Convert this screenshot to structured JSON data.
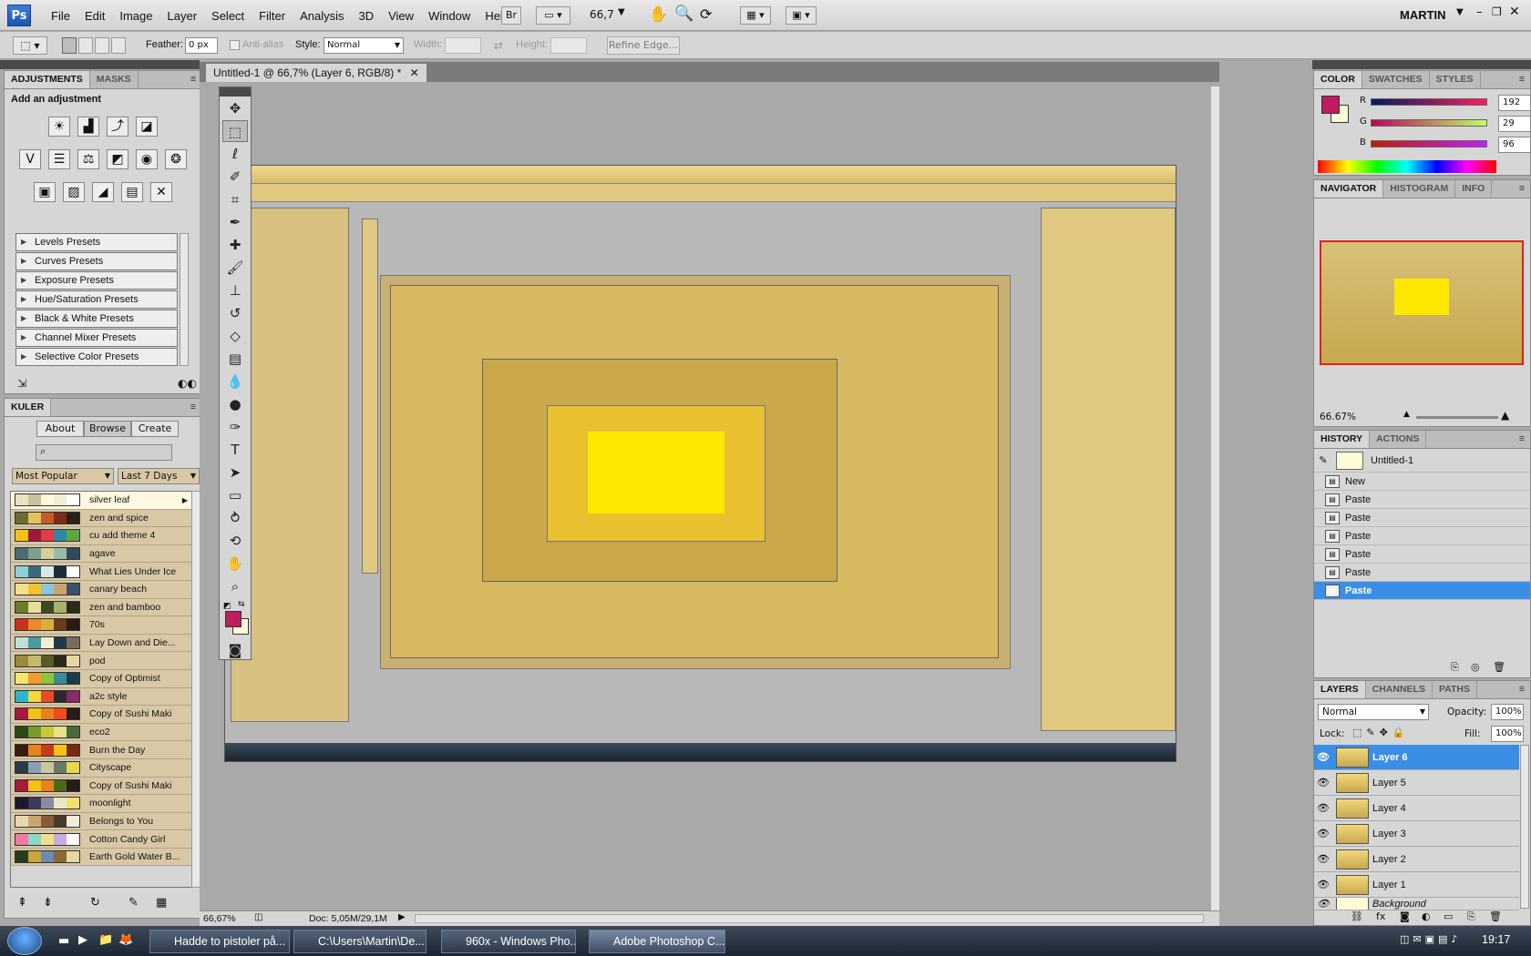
{
  "app": {
    "logo": "Ps",
    "user": "MARTIN"
  },
  "menu": [
    "File",
    "Edit",
    "Image",
    "Layer",
    "Select",
    "Filter",
    "Analysis",
    "3D",
    "View",
    "Window",
    "Help"
  ],
  "menubar": {
    "bridge": "Br",
    "zoom": "66,7"
  },
  "options": {
    "feather_label": "Feather:",
    "feather_value": "0 px",
    "antialias": "Anti-alias",
    "style_label": "Style:",
    "style_value": "Normal",
    "width_label": "Width:",
    "height_label": "Height:",
    "refine": "Refine Edge..."
  },
  "adjustments": {
    "tabs": [
      "ADJUSTMENTS",
      "MASKS"
    ],
    "title": "Add an adjustment",
    "presets": [
      "Levels Presets",
      "Curves Presets",
      "Exposure Presets",
      "Hue/Saturation Presets",
      "Black & White Presets",
      "Channel Mixer Presets",
      "Selective Color Presets"
    ]
  },
  "kuler": {
    "tab": "KULER",
    "buttons": [
      "About",
      "Browse",
      "Create"
    ],
    "filter1": "Most Popular",
    "filter2": "Last 7 Days",
    "themes": [
      {
        "name": "silver leaf",
        "colors": [
          "#e9e2c4",
          "#c9c29a",
          "#fff8d8",
          "#f2ecd2",
          "#ffffff"
        ]
      },
      {
        "name": "zen and spice",
        "colors": [
          "#6b6b33",
          "#e4c35a",
          "#c75b2a",
          "#7a2d18",
          "#2b2016"
        ]
      },
      {
        "name": "cu add theme 4",
        "colors": [
          "#f2c316",
          "#9c1a3a",
          "#e23b4a",
          "#2b8aa6",
          "#5ba63e"
        ]
      },
      {
        "name": "agave",
        "colors": [
          "#4d6c72",
          "#7e9f88",
          "#d5cf9c",
          "#9cb9a8",
          "#2f4a58"
        ]
      },
      {
        "name": "What Lies Under Ice",
        "colors": [
          "#8fd0d8",
          "#3a6a7a",
          "#d8e8e4",
          "#1c2c3a",
          "#ffffff"
        ]
      },
      {
        "name": "canary beach",
        "colors": [
          "#f7e08a",
          "#f3c32b",
          "#8fc5d8",
          "#c9a66a",
          "#3a5070"
        ]
      },
      {
        "name": "zen and bamboo",
        "colors": [
          "#6b7a2b",
          "#e8dc9a",
          "#3a4a1c",
          "#a8b26a",
          "#2a2a18"
        ]
      },
      {
        "name": "70s",
        "colors": [
          "#c8321c",
          "#e88a2a",
          "#d8b03a",
          "#6a3a1a",
          "#2a1a10"
        ]
      },
      {
        "name": "Lay Down and Die...",
        "colors": [
          "#bfe0d8",
          "#4a9aa0",
          "#f2ecd2",
          "#1c3a48",
          "#7a6a5a"
        ]
      },
      {
        "name": "pod",
        "colors": [
          "#9a8a3a",
          "#c8b86a",
          "#5a5a2a",
          "#2a2a1a",
          "#e8d8a0"
        ]
      },
      {
        "name": "Copy of Optimist",
        "colors": [
          "#f5e66a",
          "#f29a2a",
          "#8ac63a",
          "#3a8a9a",
          "#1a3a4a"
        ]
      },
      {
        "name": "a2c style",
        "colors": [
          "#2ab8c8",
          "#f2d83a",
          "#e84a2a",
          "#2a2a2a",
          "#8a2a6a"
        ]
      },
      {
        "name": "Copy of Sushi Maki",
        "colors": [
          "#a81a3a",
          "#f2c316",
          "#e8831c",
          "#f24a1c",
          "#2a1a1a"
        ]
      },
      {
        "name": "eco2",
        "colors": [
          "#2a4a1a",
          "#7a9a2a",
          "#c8c83a",
          "#e8e08a",
          "#4a6a3a"
        ]
      },
      {
        "name": "Burn the Day",
        "colors": [
          "#3a1a0a",
          "#e8831c",
          "#c83a1a",
          "#f2c316",
          "#7a2a0a"
        ]
      },
      {
        "name": "Cityscape",
        "colors": [
          "#2a3a4a",
          "#8aa0b0",
          "#c8c8a0",
          "#6a7a6a",
          "#e8d84a"
        ]
      },
      {
        "name": "Copy of Sushi Maki",
        "colors": [
          "#a81a3a",
          "#f2c316",
          "#e8831c",
          "#4a6a1a",
          "#2a1a1a"
        ]
      },
      {
        "name": "moonlight",
        "colors": [
          "#1a1a2a",
          "#3a3a5a",
          "#8a8aa0",
          "#e8e8c8",
          "#f2e06a"
        ]
      },
      {
        "name": "Belongs to You",
        "colors": [
          "#e8d8b0",
          "#c8a86a",
          "#8a5a3a",
          "#4a3a2a",
          "#f2ecd8"
        ]
      },
      {
        "name": "Cotton Candy Girl",
        "colors": [
          "#f27aa0",
          "#8ad8c8",
          "#f2e08a",
          "#c8a8e8",
          "#ffffff"
        ]
      },
      {
        "name": "Earth Gold Water B...",
        "colors": [
          "#2a3a1a",
          "#c8a83a",
          "#6a8ab0",
          "#8a6a3a",
          "#e8d8a0"
        ]
      }
    ]
  },
  "document": {
    "tab": "Untitled-1 @ 66,7% (Layer 6, RGB/8) *",
    "zoom": "66,67%",
    "doc_info": "Doc: 5,05M/29,1M"
  },
  "color": {
    "tabs": [
      "COLOR",
      "SWATCHES",
      "STYLES"
    ],
    "r": "192",
    "g": "29",
    "b": "96",
    "fg": "#c01d60",
    "r_label": "R",
    "g_label": "G",
    "b_label": "B"
  },
  "navigator": {
    "tabs": [
      "NAVIGATOR",
      "HISTOGRAM",
      "INFO"
    ],
    "zoom": "66.67%"
  },
  "history": {
    "tabs": [
      "HISTORY",
      "ACTIONS"
    ],
    "snapshot": "Untitled-1",
    "items": [
      "New",
      "Paste",
      "Paste",
      "Paste",
      "Paste",
      "Paste",
      "Paste"
    ]
  },
  "layers": {
    "tabs": [
      "LAYERS",
      "CHANNELS",
      "PATHS"
    ],
    "blend": "Normal",
    "opacity_label": "Opacity:",
    "opacity": "100%",
    "lock_label": "Lock:",
    "fill_label": "Fill:",
    "fill": "100%",
    "items": [
      "Layer 6",
      "Layer 5",
      "Layer 4",
      "Layer 3",
      "Layer 2",
      "Layer 1",
      "Background"
    ]
  },
  "taskbar": {
    "items": [
      "Hadde to pistoler på...",
      "C:\\Users\\Martin\\De...",
      "960x - Windows Pho...",
      "Adobe Photoshop C..."
    ],
    "time": "19:17"
  }
}
